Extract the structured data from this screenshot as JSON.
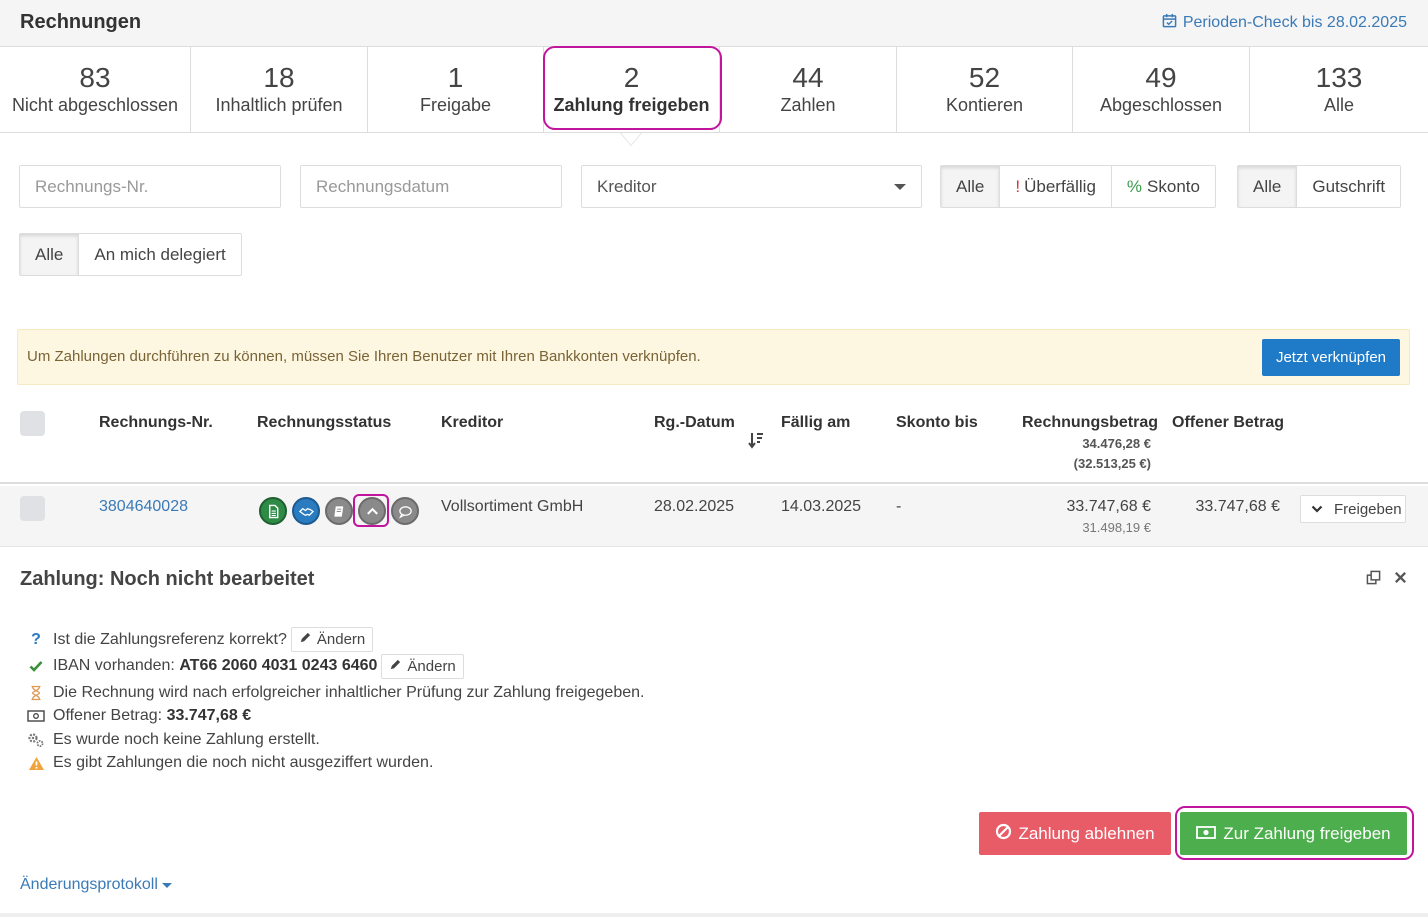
{
  "header": {
    "title": "Rechnungen",
    "period_check": "Perioden-Check bis 28.02.2025"
  },
  "tabs": [
    {
      "count": "83",
      "label": "Nicht abgeschlossen"
    },
    {
      "count": "18",
      "label": "Inhaltlich prüfen"
    },
    {
      "count": "1",
      "label": "Freigabe"
    },
    {
      "count": "2",
      "label": "Zahlung freigeben"
    },
    {
      "count": "44",
      "label": "Zahlen"
    },
    {
      "count": "52",
      "label": "Kontieren"
    },
    {
      "count": "49",
      "label": "Abgeschlossen"
    },
    {
      "count": "133",
      "label": "Alle"
    }
  ],
  "filters": {
    "invoice_no_placeholder": "Rechnungs-Nr.",
    "invoice_date_placeholder": "Rechnungsdatum",
    "creditor_selected": "Kreditor",
    "due_group": {
      "all": "Alle",
      "overdue_mark": "!",
      "overdue": "Überfällig",
      "discount_mark": "%",
      "discount": "Skonto"
    },
    "type_group": {
      "all": "Alle",
      "credit": "Gutschrift"
    },
    "delegation_group": {
      "all": "Alle",
      "delegated": "An mich delegiert"
    }
  },
  "alert": {
    "text": "Um Zahlungen durchführen zu können, müssen Sie Ihren Benutzer mit Ihren Bankkonten verknüpfen.",
    "button": "Jetzt verknüpfen"
  },
  "table": {
    "headers": {
      "invoice_no": "Rechnungs-Nr.",
      "status": "Rechnungsstatus",
      "creditor": "Kreditor",
      "invoice_date": "Rg.-Datum",
      "due": "Fällig am",
      "discount_until": "Skonto bis",
      "amount": "Rechnungsbetrag",
      "amount_total": "34.476,28 €",
      "amount_total_discount": "(32.513,25 €)",
      "open_amount": "Offener Betrag"
    },
    "rows": [
      {
        "invoice_no": "3804640028",
        "creditor": "Vollsortiment GmbH",
        "invoice_date": "28.02.2025",
        "due": "14.03.2025",
        "discount_until": "-",
        "amount": "33.747,68 €",
        "amount_discount": "31.498,19 €",
        "open_amount": "33.747,68 €",
        "action": "Freigeben"
      }
    ]
  },
  "detail": {
    "title": "Zahlung: Noch nicht bearbeitet",
    "ref_question": "Ist die Zahlungsreferenz korrekt?",
    "edit_label": "Ändern",
    "iban_label": "IBAN vorhanden:",
    "iban_value": "AT66 2060 4031 0243 6460",
    "release_info": "Die Rechnung wird nach erfolgreicher inhaltlicher Prüfung zur Zahlung freigegeben.",
    "open_label": "Offener Betrag:",
    "open_value": "33.747,68 €",
    "no_payment": "Es wurde noch keine Zahlung erstellt.",
    "warning": "Es gibt Zahlungen die noch nicht ausgeziffert wurden.",
    "reject_button": "Zahlung ablehnen",
    "approve_button": "Zur Zahlung freigeben",
    "changelog": "Änderungsprotokoll"
  },
  "colors": {
    "link": "#3a7ab7",
    "highlight": "#c0159c",
    "reject": "#e85c68",
    "approve": "#4cae4c",
    "primary": "#1f7ac8",
    "alert_bg": "#fdf6e1"
  }
}
